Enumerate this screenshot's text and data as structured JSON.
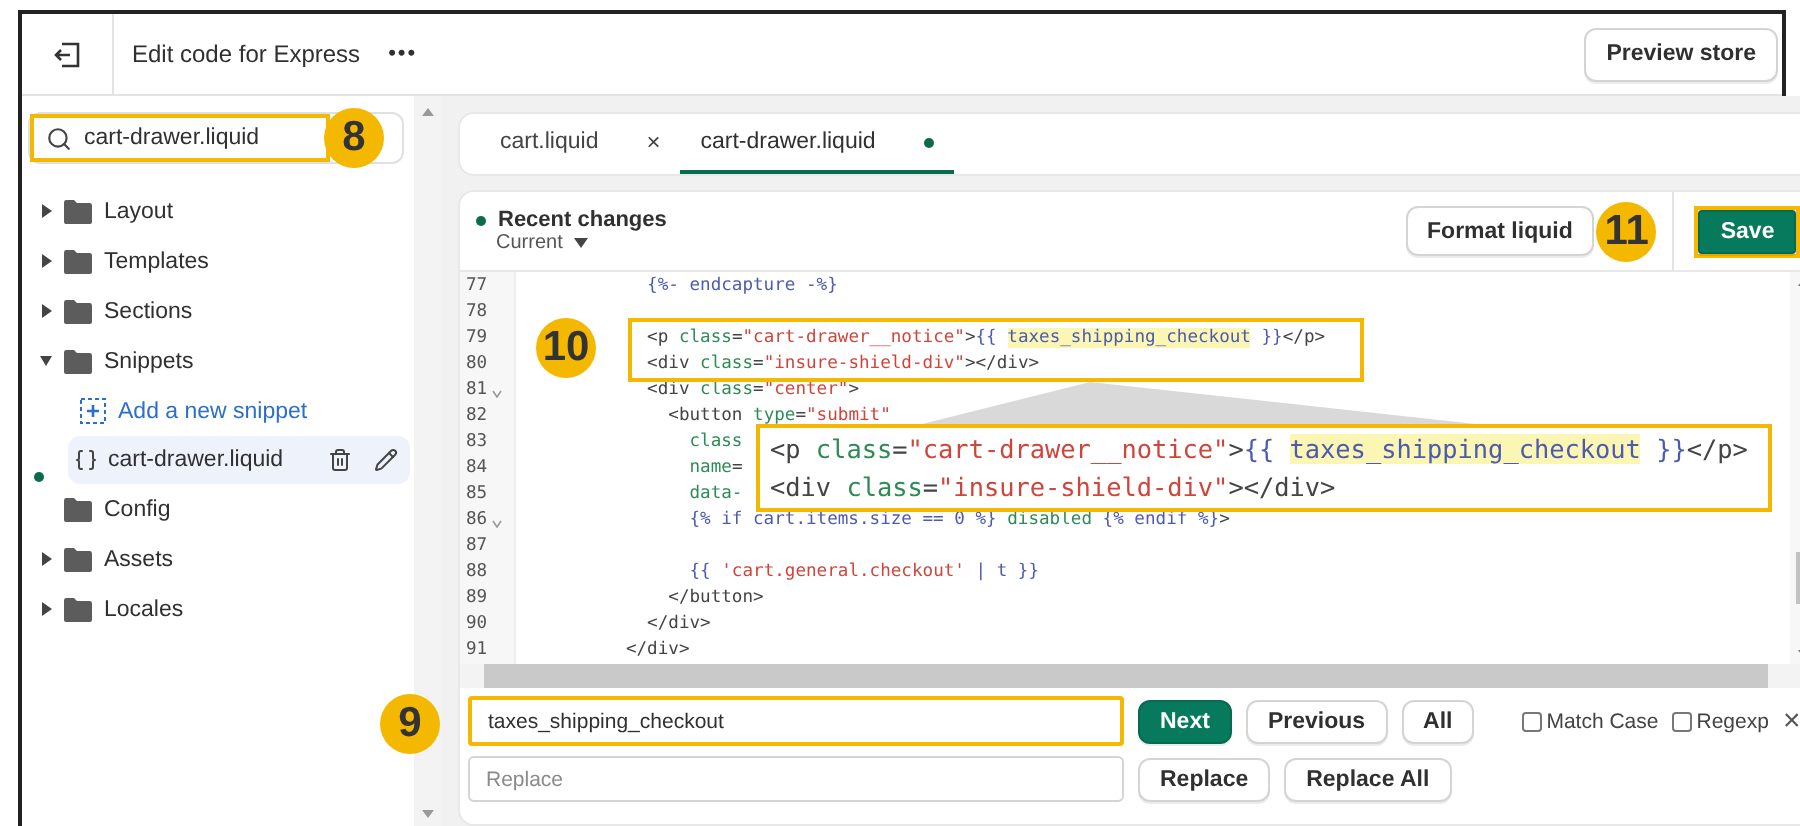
{
  "topbar": {
    "title": "Edit code for Express",
    "more": "•••",
    "preview_button": "Preview store"
  },
  "sidebar": {
    "search": {
      "value": "cart-drawer.liquid",
      "badge": "8"
    },
    "items": [
      {
        "kind": "folder",
        "label": "Layout",
        "expanded": false
      },
      {
        "kind": "folder",
        "label": "Templates",
        "expanded": false
      },
      {
        "kind": "folder",
        "label": "Sections",
        "expanded": false
      },
      {
        "kind": "folder",
        "label": "Snippets",
        "expanded": true,
        "children": [
          {
            "kind": "add",
            "label": "Add a new snippet"
          },
          {
            "kind": "file",
            "label": "cart-drawer.liquid",
            "selected": true,
            "modified": true
          }
        ]
      },
      {
        "kind": "plain-folder",
        "label": "Config"
      },
      {
        "kind": "folder",
        "label": "Assets",
        "expanded": false
      },
      {
        "kind": "folder",
        "label": "Locales",
        "expanded": false
      }
    ]
  },
  "tabs": [
    {
      "label": "cart.liquid",
      "selected": false,
      "modified": false,
      "close": "×"
    },
    {
      "label": "cart-drawer.liquid",
      "selected": true,
      "modified": true
    }
  ],
  "editor": {
    "recent_changes": "Recent changes",
    "version": "Current",
    "format_button": "Format liquid",
    "save_button": "Save",
    "save_badge": "11",
    "code_badge": "10",
    "lines": [
      {
        "number": "77",
        "foldable": false,
        "code": [
          {
            "kind": "liquid",
            "text": "            {%- endcapture -%}"
          }
        ]
      },
      {
        "number": "78",
        "foldable": false
      },
      {
        "number": "79",
        "foldable": false,
        "code": [
          {
            "kind": "tag",
            "text": "            <p "
          },
          {
            "kind": "attr",
            "text": "class"
          },
          {
            "kind": "tag",
            "text": "="
          },
          {
            "kind": "str",
            "text": "\"cart-drawer__notice\""
          },
          {
            "kind": "tag",
            "text": ">"
          },
          {
            "kind": "liquid",
            "text": "{{ "
          },
          {
            "kind": "match",
            "text": "taxes_shipping_checkout"
          },
          {
            "kind": "liquid",
            "text": " }}"
          },
          {
            "kind": "tag",
            "text": "</p>"
          }
        ]
      },
      {
        "number": "80",
        "foldable": false,
        "code": [
          {
            "kind": "tag",
            "text": "            <div "
          },
          {
            "kind": "attr",
            "text": "class"
          },
          {
            "kind": "tag",
            "text": "="
          },
          {
            "kind": "str",
            "text": "\"insure-shield-div\""
          },
          {
            "kind": "tag",
            "text": "></div>"
          }
        ]
      },
      {
        "number": "81",
        "foldable": true,
        "code": [
          {
            "kind": "tag",
            "text": "            <div "
          },
          {
            "kind": "attr",
            "text": "class"
          },
          {
            "kind": "tag",
            "text": "="
          },
          {
            "kind": "str",
            "text": "\"center\""
          },
          {
            "kind": "tag",
            "text": ">"
          }
        ]
      },
      {
        "number": "82",
        "foldable": false,
        "code": [
          {
            "kind": "tag",
            "text": "              <button "
          },
          {
            "kind": "attr",
            "text": "type"
          },
          {
            "kind": "tag",
            "text": "="
          },
          {
            "kind": "str",
            "text": "\"submit\""
          }
        ]
      },
      {
        "number": "83",
        "foldable": false,
        "code": [
          {
            "kind": "attr",
            "text": "                class"
          }
        ]
      },
      {
        "number": "84",
        "foldable": false,
        "code": [
          {
            "kind": "attr",
            "text": "                name"
          },
          {
            "kind": "tag",
            "text": "="
          }
        ]
      },
      {
        "number": "85",
        "foldable": false,
        "code": [
          {
            "kind": "attr",
            "text": "                data-"
          }
        ]
      },
      {
        "number": "86",
        "foldable": true,
        "code": [
          {
            "kind": "liquid",
            "text": "                {% if cart.items.size == 0 %} "
          },
          {
            "kind": "attr",
            "text": "disabled"
          },
          {
            "kind": "liquid",
            "text": " {% endif %}"
          },
          {
            "kind": "tag",
            "text": ">"
          }
        ]
      },
      {
        "number": "87",
        "foldable": false
      },
      {
        "number": "88",
        "foldable": false,
        "code": [
          {
            "kind": "liquid",
            "text": "                {{ "
          },
          {
            "kind": "str",
            "text": "'cart.general.checkout'"
          },
          {
            "kind": "liquid",
            "text": " | t }}"
          }
        ]
      },
      {
        "number": "89",
        "foldable": false,
        "code": [
          {
            "kind": "tag",
            "text": "              </button>"
          }
        ]
      },
      {
        "number": "90",
        "foldable": false,
        "code": [
          {
            "kind": "tag",
            "text": "            </div>"
          }
        ]
      },
      {
        "number": "91",
        "foldable": false,
        "code": [
          {
            "kind": "tag",
            "text": "          </div>"
          }
        ]
      }
    ],
    "callout": [
      [
        {
          "kind": "tag",
          "text": "<p "
        },
        {
          "kind": "attr",
          "text": "class"
        },
        {
          "kind": "tag",
          "text": "="
        },
        {
          "kind": "str",
          "text": "\"cart-drawer__notice\""
        },
        {
          "kind": "tag",
          "text": ">"
        },
        {
          "kind": "liquid",
          "text": "{{ "
        },
        {
          "kind": "match",
          "text": "taxes_shipping_checkout"
        },
        {
          "kind": "liquid",
          "text": " }}"
        },
        {
          "kind": "tag",
          "text": "</p>"
        }
      ],
      [
        {
          "kind": "tag",
          "text": "<div "
        },
        {
          "kind": "attr",
          "text": "class"
        },
        {
          "kind": "tag",
          "text": "="
        },
        {
          "kind": "str",
          "text": "\"insure-shield-div\""
        },
        {
          "kind": "tag",
          "text": "></div>"
        }
      ]
    ]
  },
  "find": {
    "value": "taxes_shipping_checkout",
    "badge": "9",
    "buttons": [
      {
        "label": "Next",
        "primary": true
      },
      {
        "label": "Previous",
        "primary": false
      },
      {
        "label": "All",
        "primary": false
      }
    ],
    "options": [
      {
        "label": "Match Case",
        "checked": false
      },
      {
        "label": "Regexp",
        "checked": false
      }
    ],
    "close": "×",
    "replace": {
      "placeholder": "Replace"
    },
    "replace_buttons": [
      "Replace",
      "Replace All"
    ]
  }
}
